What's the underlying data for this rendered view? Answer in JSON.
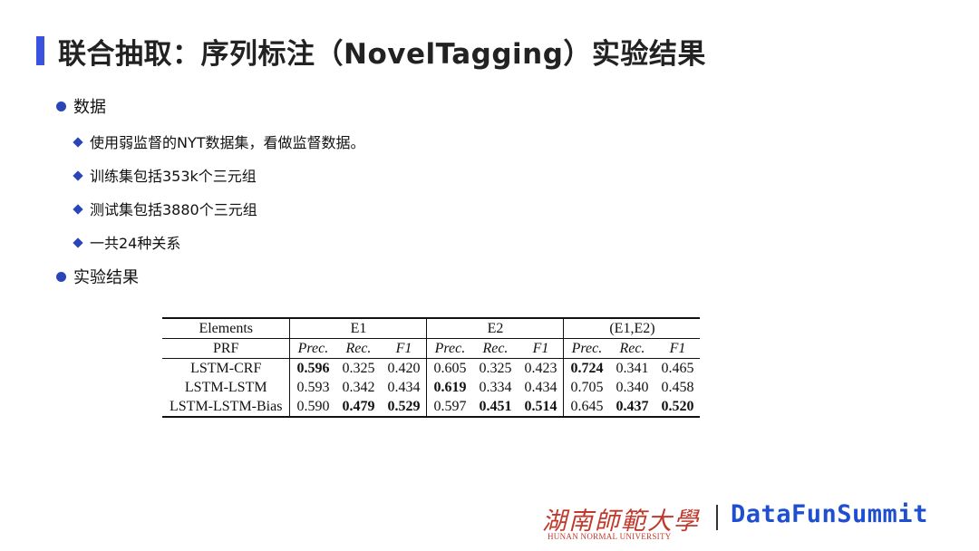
{
  "title": "联合抽取：序列标注（NovelTagging）实验结果",
  "sections": [
    {
      "label": "数据",
      "items": [
        "使用弱监督的NYT数据集，看做监督数据。",
        "训练集包括353k个三元组",
        "测试集包括3880个三元组",
        "一共24种关系"
      ]
    },
    {
      "label": "实验结果"
    }
  ],
  "table": {
    "col_header": "Elements",
    "sub_header": "PRF",
    "groups": [
      "E1",
      "E2",
      "(E1,E2)"
    ],
    "metrics": [
      "Prec.",
      "Rec.",
      "F1"
    ],
    "rows": [
      {
        "name": "LSTM-CRF",
        "values": [
          "0.596",
          "0.325",
          "0.420",
          "0.605",
          "0.325",
          "0.423",
          "0.724",
          "0.341",
          "0.465"
        ],
        "bold": [
          0,
          6
        ]
      },
      {
        "name": "LSTM-LSTM",
        "values": [
          "0.593",
          "0.342",
          "0.434",
          "0.619",
          "0.334",
          "0.434",
          "0.705",
          "0.340",
          "0.458"
        ],
        "bold": [
          3
        ]
      },
      {
        "name": "LSTM-LSTM-Bias",
        "values": [
          "0.590",
          "0.479",
          "0.529",
          "0.597",
          "0.451",
          "0.514",
          "0.645",
          "0.437",
          "0.520"
        ],
        "bold": [
          1,
          2,
          4,
          5,
          7,
          8
        ]
      }
    ]
  },
  "footer": {
    "university_cn": "湖南師範大學",
    "university_en": "HUNAN NORMAL UNIVERSITY",
    "brand": "DataFunSummit"
  },
  "colors": {
    "accent": "#3a52e0",
    "bullet": "#2a45b8",
    "brand": "#1f4fd1",
    "logo": "#c0392b"
  }
}
